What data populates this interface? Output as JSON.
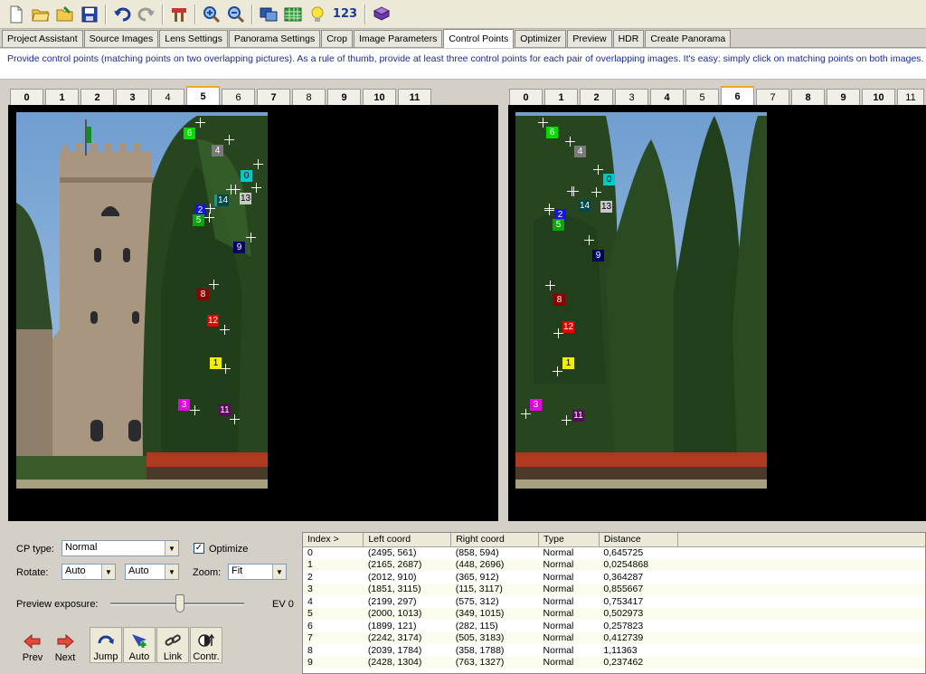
{
  "toolbar": {
    "buttons": [
      "new-icon",
      "open-icon",
      "open-project-icon",
      "save-icon",
      "undo-icon",
      "redo-icon",
      "tools-icon",
      "zoom-in-icon",
      "zoom-out-icon",
      "preview-icon",
      "table-icon",
      "tip-icon",
      "number-icon",
      "manual-icon"
    ],
    "number_label": "123"
  },
  "tabs": [
    "Project Assistant",
    "Source Images",
    "Lens Settings",
    "Panorama Settings",
    "Crop",
    "Image Parameters",
    "Control Points",
    "Optimizer",
    "Preview",
    "HDR",
    "Create Panorama"
  ],
  "active_tab": "Control Points",
  "instructions": "Provide control points (matching points on two overlapping pictures). As a rule of thumb, provide at least three control points for each pair of overlapping images. It's easy: simply click on matching points on both images.",
  "left_image_tabs": [
    "0",
    "1",
    "2",
    "3",
    "4",
    "5",
    "6",
    "7",
    "8",
    "9",
    "10",
    "11"
  ],
  "right_image_tabs": [
    "0",
    "1",
    "2",
    "3",
    "4",
    "5",
    "6",
    "7",
    "8",
    "9",
    "10",
    "11"
  ],
  "left_active": "5",
  "right_active": "6",
  "colors": {
    "cp0": "#00c8c8",
    "cp1": "#f0f000",
    "cp2": "#1414e6",
    "cp3": "#e600e6",
    "cp4": "#7a7a7a",
    "cp5": "#0aa60a",
    "cp6": "#00dd00",
    "cp7": "#00a0a0",
    "cp8": "#8b0000",
    "cp9": "#00005a",
    "cp10": "#ffffff",
    "cp11": "#5a0a5a",
    "cp12": "#e60000",
    "cp13": "#c8c8c8",
    "cp14": "#004848"
  },
  "controls": {
    "cp_type_label": "CP type:",
    "cp_type_value": "Normal",
    "optimize_label": "Optimize",
    "optimize_checked": true,
    "rotate_label": "Rotate:",
    "rotate_left": "Auto",
    "rotate_right": "Auto",
    "zoom_label": "Zoom:",
    "zoom_value": "Fit",
    "exposure_label": "Preview exposure:",
    "exposure_value": "EV 0",
    "prev_label": "Prev",
    "next_label": "Next",
    "jump_label": "Jump",
    "auto_label": "Auto",
    "link_label": "Link",
    "contr_label": "Contr."
  },
  "table": {
    "headers": [
      "Index >",
      "Left coord",
      "Right coord",
      "Type",
      "Distance"
    ],
    "rows": [
      [
        "0",
        "(2495, 561)",
        "(858, 594)",
        "Normal",
        "0,645725"
      ],
      [
        "1",
        "(2165, 2687)",
        "(448, 2696)",
        "Normal",
        "0,0254868"
      ],
      [
        "2",
        "(2012, 910)",
        "(365, 912)",
        "Normal",
        "0,364287"
      ],
      [
        "3",
        "(1851, 3115)",
        "(115, 3117)",
        "Normal",
        "0,855667"
      ],
      [
        "4",
        "(2199, 297)",
        "(575, 312)",
        "Normal",
        "0,753417"
      ],
      [
        "5",
        "(2000, 1013)",
        "(349, 1015)",
        "Normal",
        "0,502973"
      ],
      [
        "6",
        "(1899, 121)",
        "(282, 115)",
        "Normal",
        "0,257823"
      ],
      [
        "7",
        "(2242, 3174)",
        "(505, 3183)",
        "Normal",
        "0,412739"
      ],
      [
        "8",
        "(2039, 1784)",
        "(358, 1788)",
        "Normal",
        "1,11363"
      ],
      [
        "9",
        "(2428, 1304)",
        "(763, 1327)",
        "Normal",
        "0,237462"
      ]
    ]
  }
}
